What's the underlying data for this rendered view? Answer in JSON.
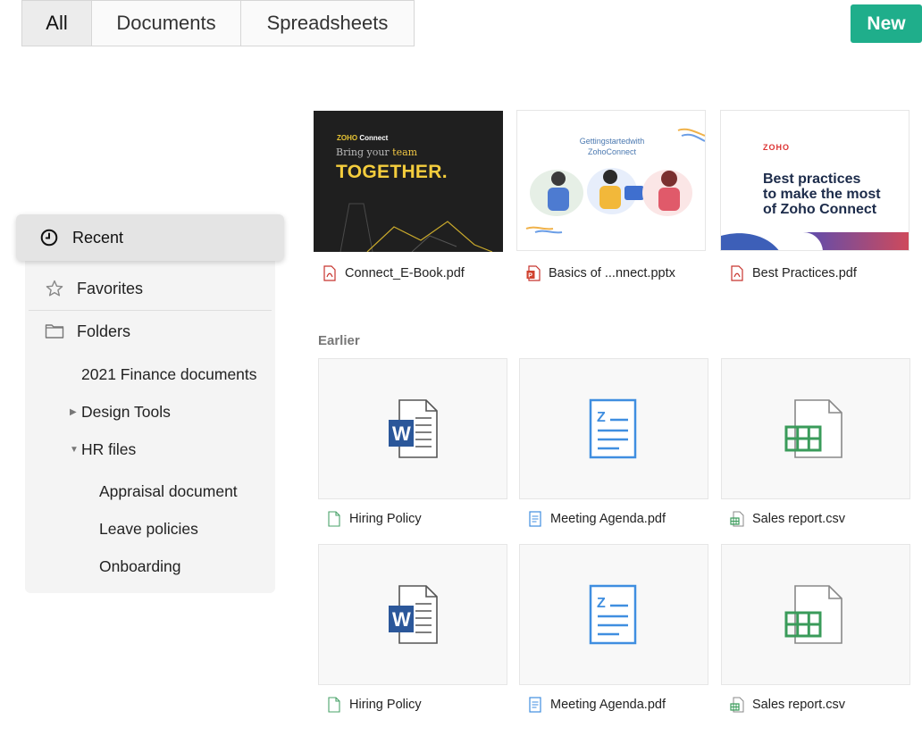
{
  "tabs": {
    "all": "All",
    "documents": "Documents",
    "spreadsheets": "Spreadsheets"
  },
  "new_button": "New",
  "sidebar": {
    "recent": "Recent",
    "favorites": "Favorites",
    "folders": "Folders",
    "folder_items": {
      "finance": "2021 Finance documents",
      "design": "Design Tools",
      "hr": "HR files",
      "appraisal": "Appraisal document",
      "leave": "Leave policies",
      "onboarding": "Onboarding"
    }
  },
  "recent_files": [
    {
      "name": "Connect_E-Book.pdf",
      "icon": "pdf-icon",
      "thumb": {
        "brand_a": "ZOHO",
        "brand_b": " Connect",
        "line1a": "Bring your ",
        "line1b": "team",
        "line2": "TOGETHER."
      }
    },
    {
      "name": "Basics of ...nnect.pptx",
      "icon": "pptx-icon",
      "thumb": {
        "title_a": "Gettingstartedwith",
        "title_b": "ZohoConnect"
      }
    },
    {
      "name": "Best Practices.pdf",
      "icon": "pdf-icon",
      "thumb": {
        "logo": "ZOHO",
        "text_a": "Best practices",
        "text_b": "to make the most",
        "text_c": "of Zoho Connect"
      }
    }
  ],
  "earlier_label": "Earlier",
  "earlier_files": {
    "row1": [
      "Hiring Policy",
      "Meeting Agenda.pdf",
      "Sales report.csv"
    ],
    "row2": [
      "Hiring Policy",
      "Meeting Agenda.pdf",
      "Sales report.csv"
    ]
  },
  "colors": {
    "accent": "#1fae8b",
    "word_blue": "#2b579a",
    "writer_blue": "#3f8ee0",
    "sheet_green": "#3a9b5a",
    "pdf_red": "#c7342e"
  }
}
